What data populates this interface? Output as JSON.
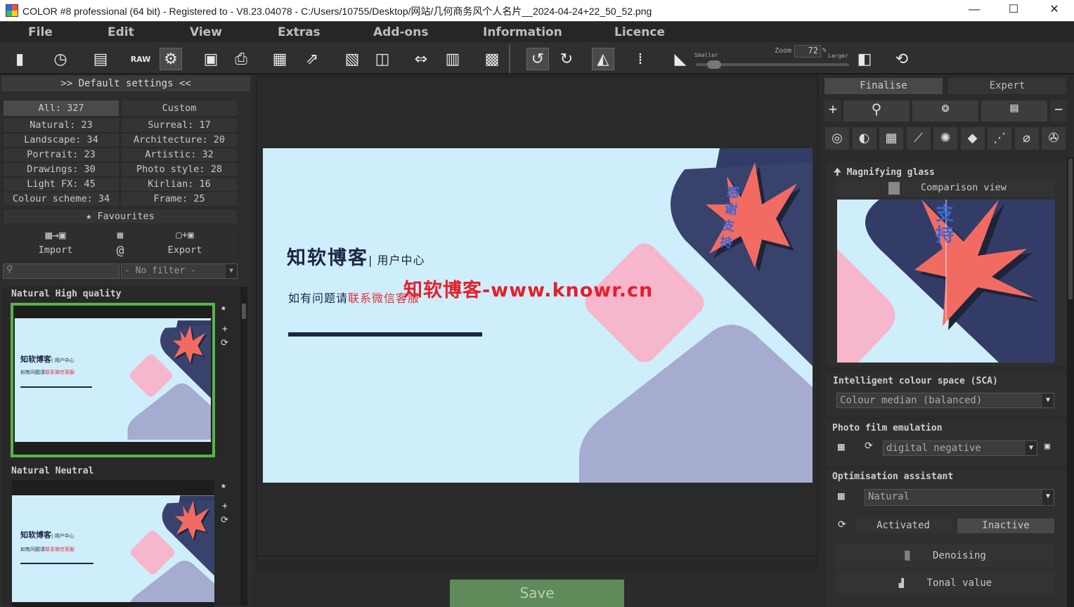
{
  "window": {
    "title": "COLOR #8 professional (64 bit) - Registered to - V8.23.04078 - C:/Users/10755/Desktop/网站/几何商务风个人名片__2024-04-24+22_50_52.png",
    "minimize": "—",
    "maximize": "☐",
    "close": "✕"
  },
  "menu": [
    "File",
    "Edit",
    "View",
    "Extras",
    "Add-ons",
    "Information",
    "Licence"
  ],
  "toolbar": {
    "zoom_label": "Zoom",
    "zoom_value": "72",
    "zoom_unit": "%",
    "smaller": "Smaller",
    "larger": "Larger",
    "zoom_slider_fraction": 0.08
  },
  "left": {
    "header": ">> Default settings <<",
    "all": "All: 327",
    "custom": "Custom",
    "categories": [
      [
        "Natural: 23",
        "Surreal: 17"
      ],
      [
        "Landscape: 34",
        "Architecture: 20"
      ],
      [
        "Portrait: 23",
        "Artistic: 32"
      ],
      [
        "Drawings: 30",
        "Photo style: 28"
      ],
      [
        "Light FX: 45",
        "Kirlian: 16"
      ],
      [
        "Colour scheme: 34",
        "Frame: 25"
      ]
    ],
    "favourites": "Favourites",
    "import": "Import",
    "export": "Export",
    "at": "@",
    "filter": "- No filter -",
    "thumb1_title": "Natural High quality",
    "thumb2_title": "Natural Neutral"
  },
  "card": {
    "brand": "知软博客",
    "center": "| 用户中心",
    "line1_a": "如有问题请",
    "line1_b": "联系微信客服",
    "star_text": "感谢支持",
    "watermark": "知软博客-www.knowr.cn",
    "colors": {
      "bg": "#cfeefb",
      "navy": "#323c66",
      "pink": "#f6b6cc",
      "lav": "#a6abd0",
      "star": "#f26b63",
      "red": "#e0303a"
    }
  },
  "save": "Save",
  "right": {
    "tab_finalise": "Finalise",
    "tab_expert": "Expert",
    "magnifier_title": "Magnifying glass",
    "comparison": "Comparison view",
    "sca_title": "Intelligent colour space (SCA)",
    "sca_value": "Colour median (balanced)",
    "film_title": "Photo film emulation",
    "film_value": "digital negative",
    "opt_title": "Optimisation assistant",
    "opt_value": "Natural",
    "activated": "Activated",
    "inactive": "Inactive",
    "denoising": "Denoising",
    "tonal": "Tonal value",
    "zoom_text": "支持"
  }
}
